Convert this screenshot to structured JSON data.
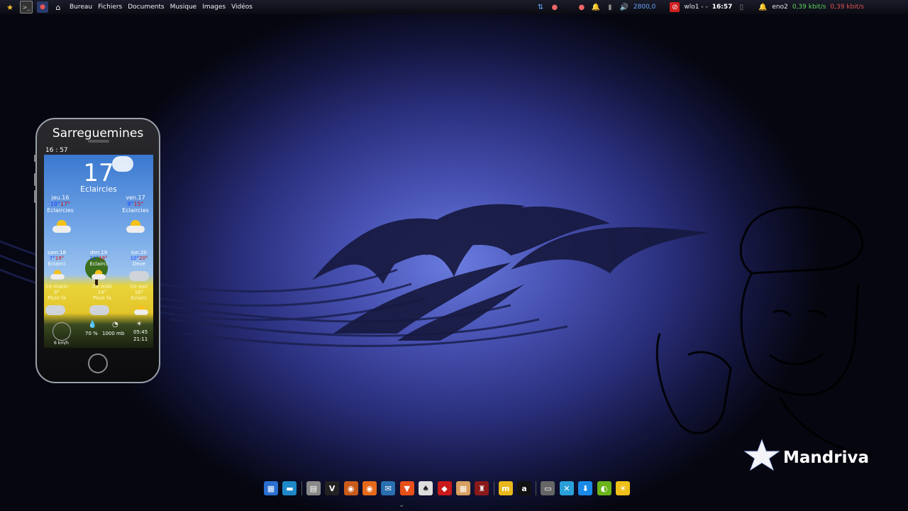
{
  "top_panel": {
    "menus": [
      "Bureau",
      "Fichiers",
      "Documents",
      "Musique",
      "Images",
      "Vidéos"
    ],
    "cpu_freq": "2800,0",
    "wifi_label": "wlo1 - -",
    "clock": "16:57",
    "eth_label": "eno2",
    "net_down": "0,39 kbit/s",
    "net_up": "0,39 kbit/s"
  },
  "weather": {
    "city": "Sarreguemines",
    "time": "16 : 57",
    "current_temp": "17",
    "current_cond": "Eclaircies",
    "day2": [
      {
        "day": "jeu.16",
        "low": "10°",
        "high": "17°",
        "cond": "Eclaircies"
      },
      {
        "day": "ven.17",
        "low": "9°",
        "high": "15°",
        "cond": "Eclaircies"
      }
    ],
    "day3": [
      {
        "day": "sam.18",
        "low": "7°",
        "high": "19°",
        "cond": "Eclairci"
      },
      {
        "day": "dim.19",
        "low": "11°",
        "high": "19°",
        "cond": "Eclairci"
      },
      {
        "day": "lun.20",
        "low": "10°",
        "high": "20°",
        "cond": "Deve"
      }
    ],
    "day4": [
      {
        "label": "Ce matin",
        "temp": "9°",
        "cond": "Pluie fa"
      },
      {
        "label": "Ce midi",
        "temp": "14°",
        "cond": "Pluie fa"
      },
      {
        "label": "Ce soir",
        "temp": "16°",
        "cond": "Eclairc"
      }
    ],
    "wind": "6 km/h",
    "humidity": "70 %",
    "pressure": "1000 mb",
    "sunrise": "05:45",
    "sunset": "21:11"
  },
  "logo": {
    "brand": "Mandriva"
  },
  "dock": {
    "apps": [
      {
        "name": "workspace-switcher",
        "color": "#2a6fd0",
        "glyph": "▦"
      },
      {
        "name": "desktop-show",
        "color": "#1e88c8",
        "glyph": "▬"
      },
      {
        "name": "file-manager",
        "color": "#888888",
        "glyph": "▤"
      },
      {
        "name": "vivaldi",
        "color": "#222222",
        "glyph": "V"
      },
      {
        "name": "firefox-dev",
        "color": "#c85a1a",
        "glyph": "◉"
      },
      {
        "name": "firefox",
        "color": "#e66a1a",
        "glyph": "◉"
      },
      {
        "name": "thunderbird",
        "color": "#2a6fb0",
        "glyph": "✉"
      },
      {
        "name": "brave",
        "color": "#e8501a",
        "glyph": "▼"
      },
      {
        "name": "solitaire",
        "color": "#dddddd",
        "glyph": "♠"
      },
      {
        "name": "dice-game",
        "color": "#c81a1a",
        "glyph": "◆"
      },
      {
        "name": "mahjongg",
        "color": "#d8a060",
        "glyph": "▦"
      },
      {
        "name": "chess",
        "color": "#8a1a1a",
        "glyph": "♜"
      },
      {
        "name": "mkvtoolnix",
        "color": "#e8b81a",
        "glyph": "m"
      },
      {
        "name": "appimage",
        "color": "#111111",
        "glyph": "a"
      },
      {
        "name": "scanner",
        "color": "#666666",
        "glyph": "▭"
      },
      {
        "name": "remote-desktop",
        "color": "#2aa0d8",
        "glyph": "✕"
      },
      {
        "name": "downloader",
        "color": "#1a8ae8",
        "glyph": "⬇"
      },
      {
        "name": "nvidia",
        "color": "#6ab41a",
        "glyph": "◐"
      },
      {
        "name": "weather-app",
        "color": "#f0c01a",
        "glyph": "☀"
      }
    ]
  }
}
